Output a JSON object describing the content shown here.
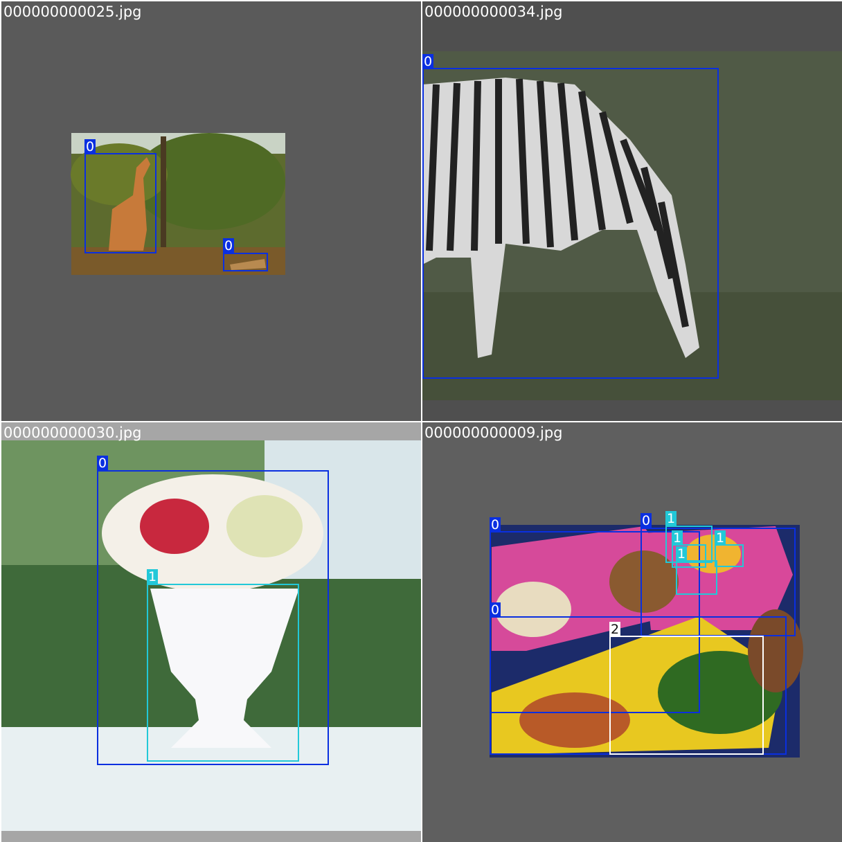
{
  "mosaic": {
    "tiles": [
      {
        "filename": "000000000025.jpg",
        "content": "giraffe",
        "boxes": [
          {
            "cls": "0",
            "color": "#0a2fe0"
          },
          {
            "cls": "0",
            "color": "#0a2fe0"
          }
        ]
      },
      {
        "filename": "000000000034.jpg",
        "content": "zebra",
        "boxes": [
          {
            "cls": "0",
            "color": "#0a2fe0"
          }
        ]
      },
      {
        "filename": "000000000030.jpg",
        "content": "flower-vase",
        "boxes": [
          {
            "cls": "0",
            "color": "#0a2fe0"
          },
          {
            "cls": "1",
            "color": "#22c8d8"
          }
        ]
      },
      {
        "filename": "000000000009.jpg",
        "content": "lunch-boxes",
        "boxes": [
          {
            "cls": "0",
            "color": "#0a2fe0"
          },
          {
            "cls": "0",
            "color": "#0a2fe0"
          },
          {
            "cls": "0",
            "color": "#0a2fe0"
          },
          {
            "cls": "1",
            "color": "#22c8d8"
          },
          {
            "cls": "1",
            "color": "#22c8d8"
          },
          {
            "cls": "1",
            "color": "#22c8d8"
          },
          {
            "cls": "1",
            "color": "#22c8d8"
          },
          {
            "cls": "2",
            "color": "#ffffff"
          }
        ]
      }
    ]
  }
}
